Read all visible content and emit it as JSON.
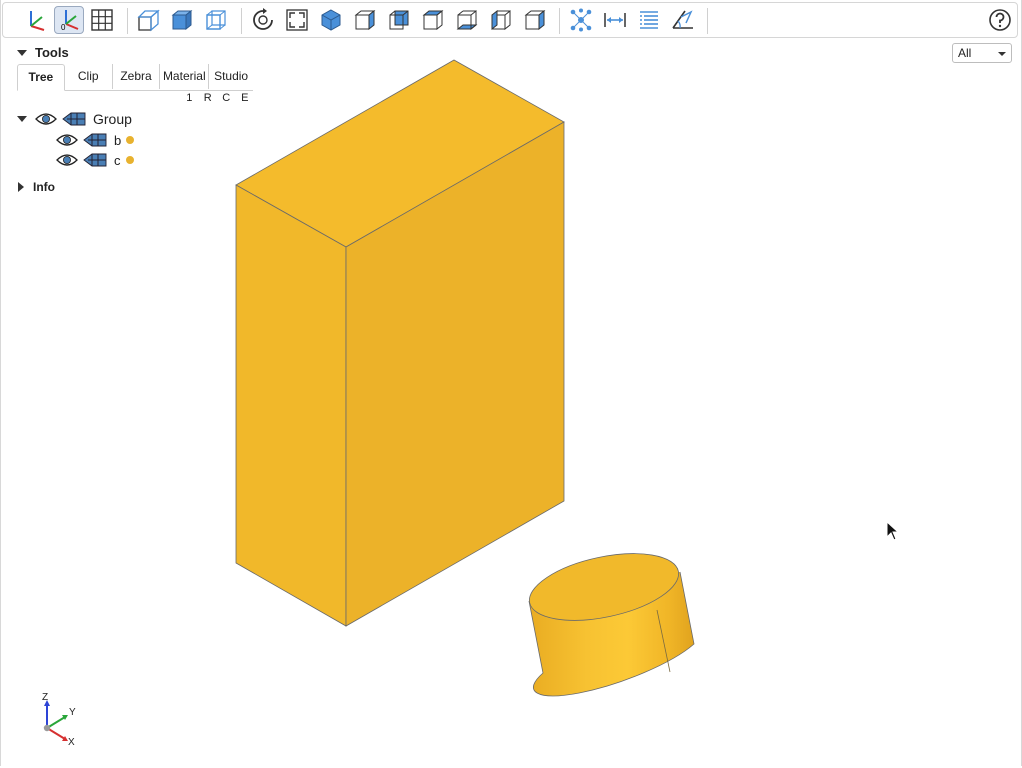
{
  "toolbar": {
    "buttons": [
      {
        "name": "axes-toggle",
        "icon": "axes-icon",
        "active": false
      },
      {
        "name": "axes0-toggle",
        "icon": "axes-origin-icon",
        "active": true
      },
      {
        "name": "grid-toggle",
        "icon": "grid-icon",
        "active": false
      },
      {
        "name": "perspective-camera",
        "icon": "perspective-cube-icon",
        "active": false
      },
      {
        "name": "ortho-camera",
        "icon": "ortho-cube-icon",
        "active": false
      },
      {
        "name": "transparent-toggle",
        "icon": "transparent-cube-icon",
        "active": false
      },
      {
        "name": "reset-view",
        "icon": "reset-icon",
        "active": false
      },
      {
        "name": "resize-view",
        "icon": "fit-icon",
        "active": false
      },
      {
        "name": "view-iso",
        "icon": "iso-view-icon",
        "active": false
      },
      {
        "name": "view-front",
        "icon": "front-view-icon",
        "active": false
      },
      {
        "name": "view-rear",
        "icon": "rear-view-icon",
        "active": false
      },
      {
        "name": "view-top",
        "icon": "top-view-icon",
        "active": false
      },
      {
        "name": "view-bottom",
        "icon": "bottom-view-icon",
        "active": false
      },
      {
        "name": "view-left",
        "icon": "left-view-icon",
        "active": false
      },
      {
        "name": "view-right",
        "icon": "right-view-icon",
        "active": false
      },
      {
        "name": "explode-tool",
        "icon": "explode-icon",
        "active": false
      },
      {
        "name": "distance-tool",
        "icon": "distance-icon",
        "active": false
      },
      {
        "name": "properties-tool",
        "icon": "properties-icon",
        "active": false
      },
      {
        "name": "angle-tool",
        "icon": "angle-icon",
        "active": false
      }
    ],
    "help_icon": "help-icon"
  },
  "tools": {
    "title": "Tools",
    "tabs": [
      "Tree",
      "Clip",
      "Zebra",
      "Material",
      "Studio"
    ],
    "active_tab": "Tree",
    "columns": [
      "1",
      "R",
      "C",
      "E"
    ]
  },
  "tree": {
    "group_label": "Group",
    "items": [
      {
        "label": "b",
        "color": "#e8b22f"
      },
      {
        "label": "c",
        "color": "#e8b22f"
      }
    ]
  },
  "info": {
    "title": "Info"
  },
  "view_select": {
    "value": "All"
  },
  "axes": {
    "z": "Z",
    "y": "Y",
    "x": "X"
  },
  "colors": {
    "shape": "#f2b829",
    "accent": "#4a90d9"
  }
}
